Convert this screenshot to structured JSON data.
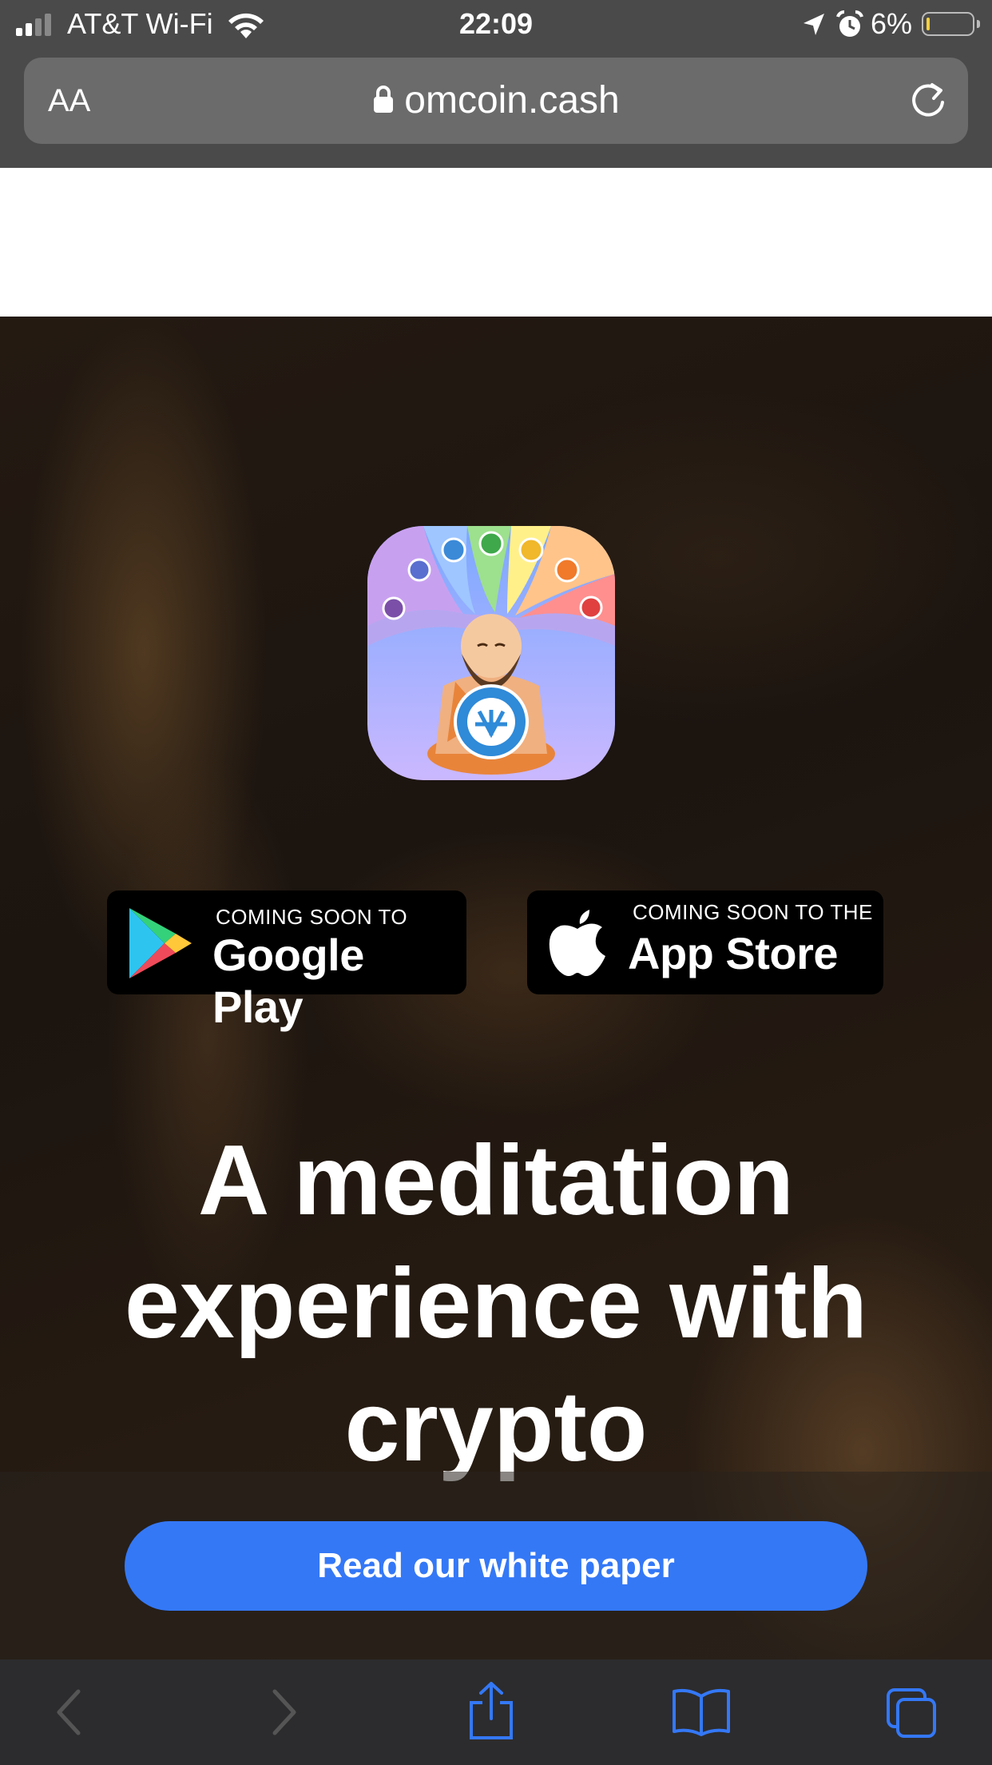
{
  "status_bar": {
    "carrier": "AT&T Wi-Fi",
    "time": "22:09",
    "battery_percent": "6%",
    "icons": [
      "signal-icon",
      "wifi-icon",
      "location-arrow-icon",
      "alarm-icon",
      "battery-icon"
    ]
  },
  "url_bar": {
    "text_size_label": "AA",
    "url": "omcoin.cash",
    "icons": [
      "lock-icon",
      "reload-icon"
    ]
  },
  "hero": {
    "app_icon": "meditating-monk-omcoin-logo",
    "google_badge": {
      "small": "COMING SOON TO",
      "big": "Google Play"
    },
    "apple_badge": {
      "small": "COMING SOON TO THE",
      "big": "App Store"
    },
    "headline": "A meditation experience with crypto"
  },
  "cta": {
    "label": "Read our white paper",
    "color": "#3478f6"
  },
  "toolbar": {
    "icons": [
      "back-icon",
      "forward-icon",
      "share-icon",
      "bookmarks-icon",
      "tabs-icon"
    ],
    "accent": "#3478f6"
  }
}
